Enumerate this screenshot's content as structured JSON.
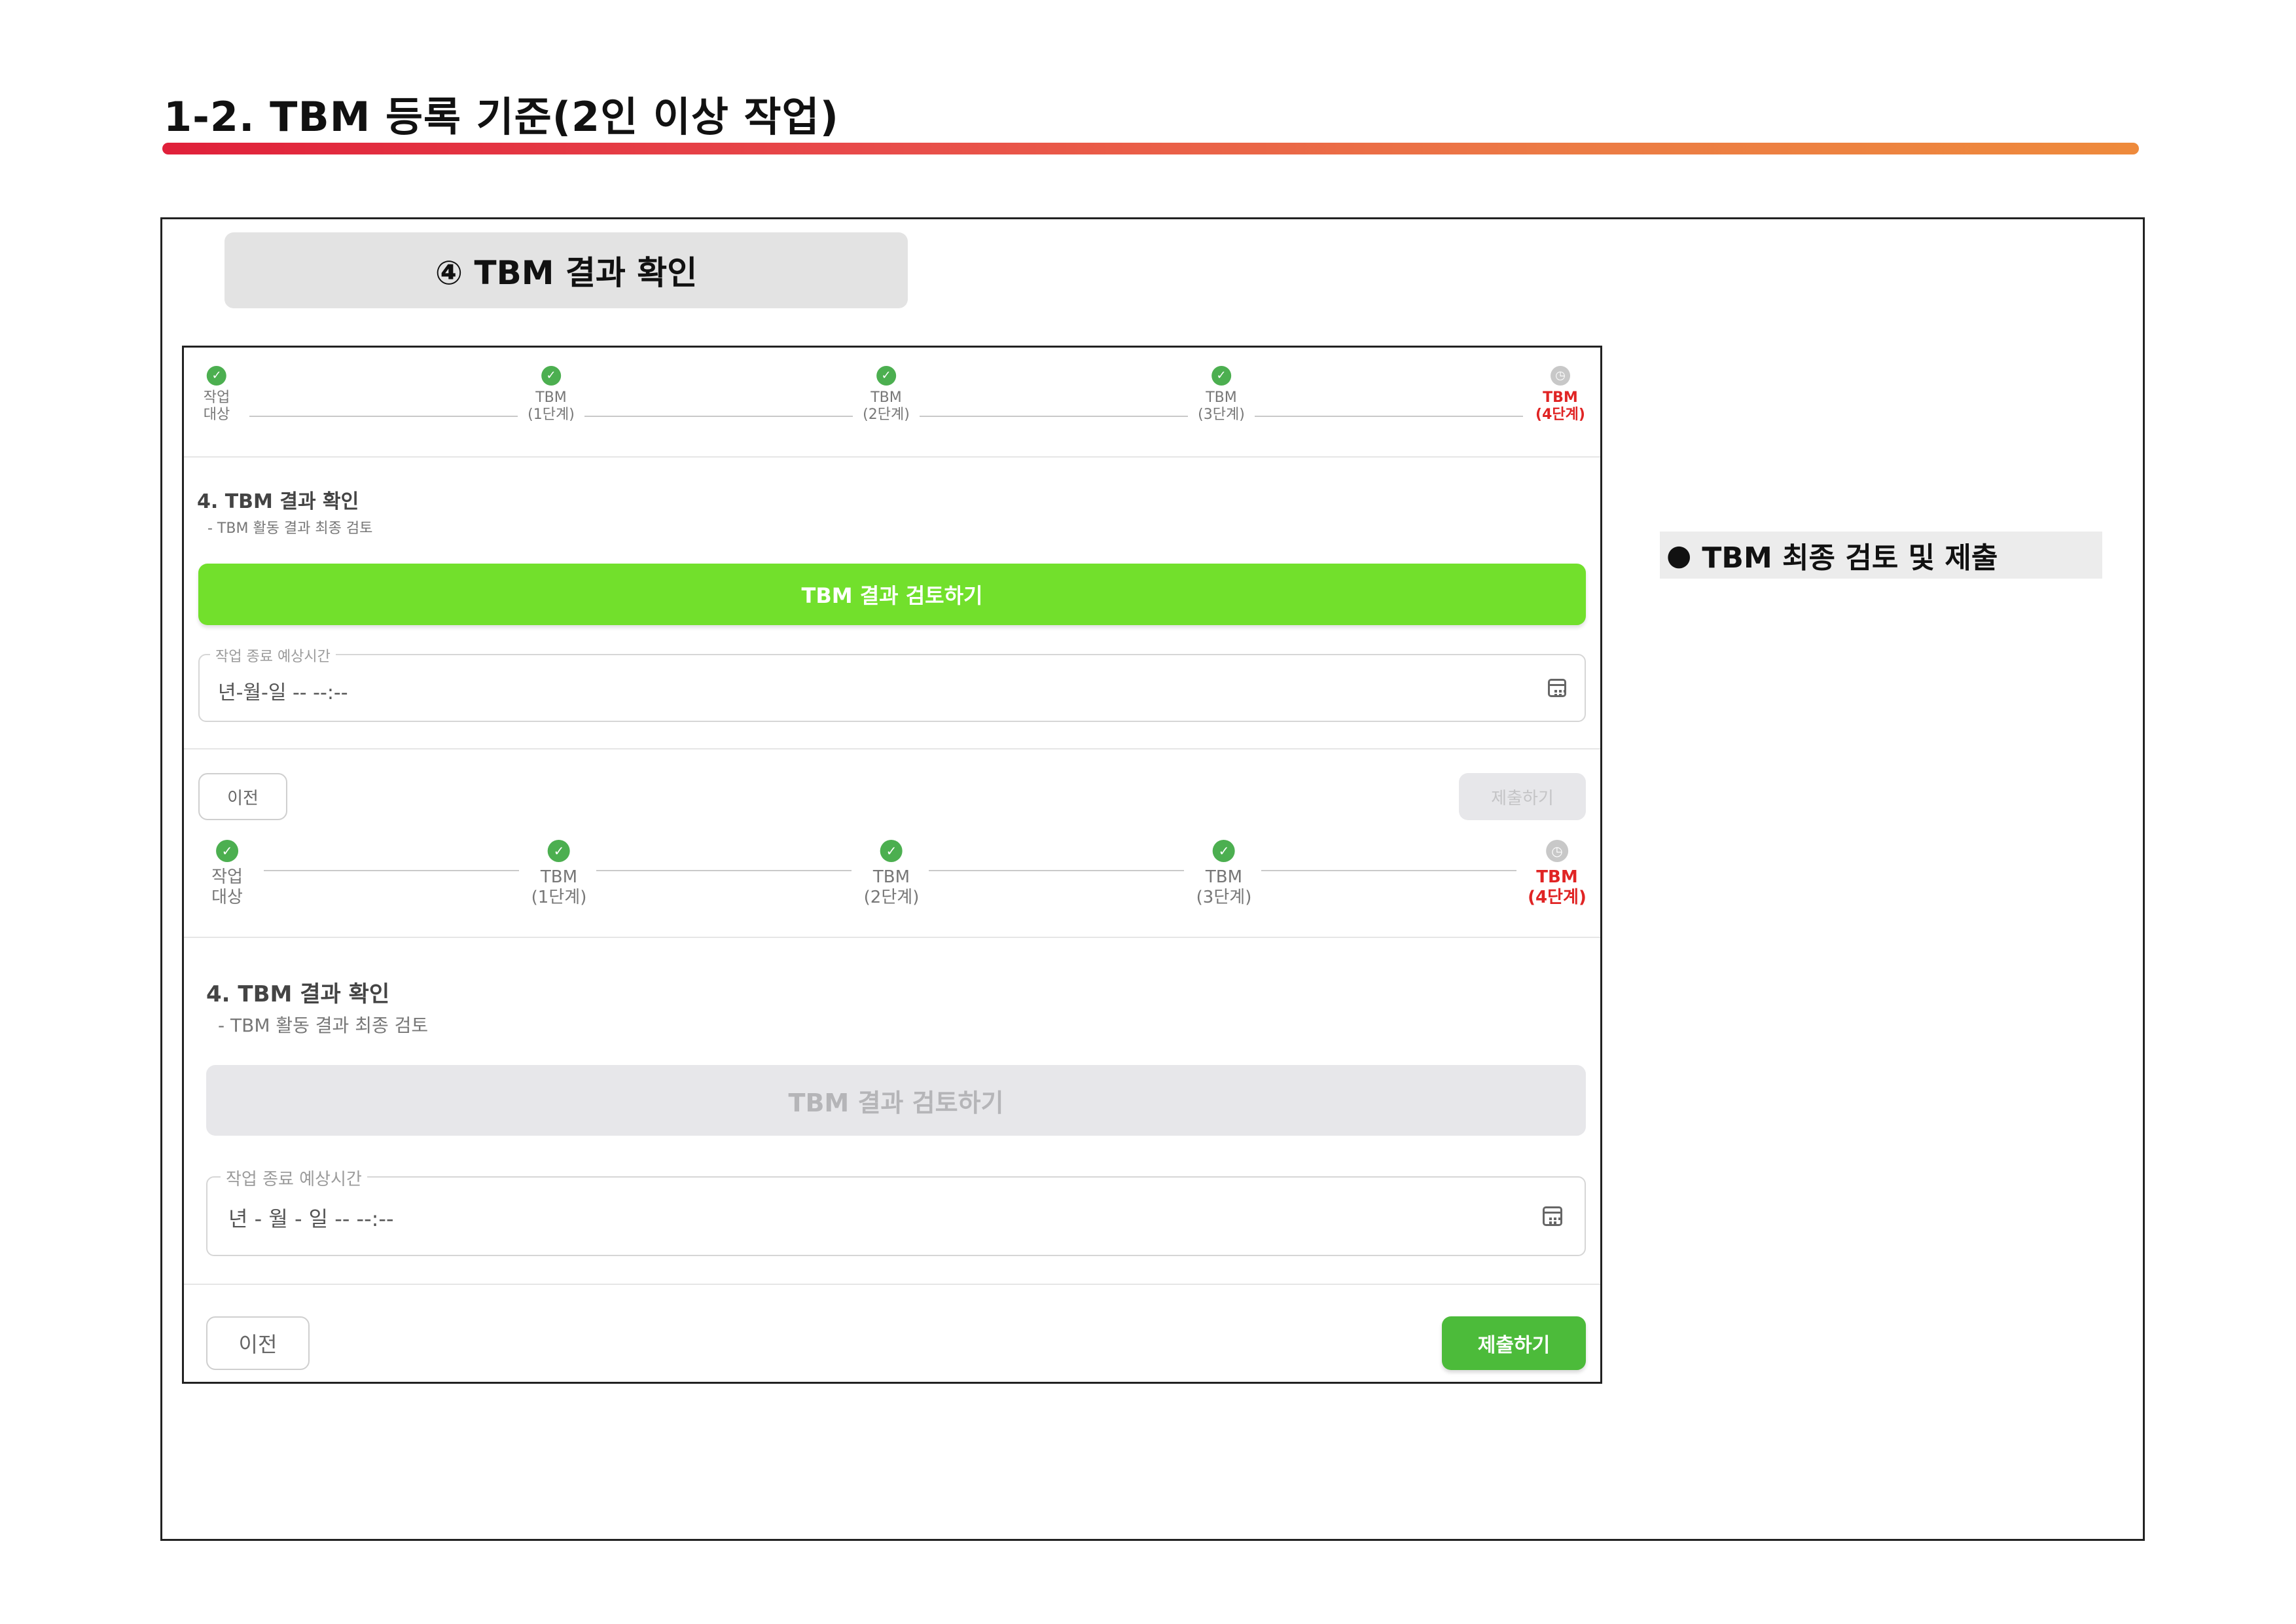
{
  "page": {
    "title": "1-2. TBM 등록 기준(2인 이상 작업)",
    "step_label": "④ TBM 결과 확인",
    "note": {
      "bullet": "●",
      "text": "TBM 최종 검토 및 제출"
    }
  },
  "colors": {
    "title_rule_start": "#e0203a",
    "title_rule_end": "#ee8a3c",
    "step_done": "#4caf50",
    "step_active_text": "#e02424",
    "review_button": "#72e02c",
    "submit_button": "#4cbb3a"
  },
  "stepper": {
    "check_icon": "✓",
    "pending_icon": "clock-icon",
    "steps": [
      {
        "line1": "작업",
        "line2": "대상",
        "state": "done"
      },
      {
        "line1": "TBM",
        "line2": "(1단계)",
        "state": "done"
      },
      {
        "line1": "TBM",
        "line2": "(2단계)",
        "state": "done"
      },
      {
        "line1": "TBM",
        "line2": "(3단계)",
        "state": "done"
      },
      {
        "line1": "TBM",
        "line2": "(4단계)",
        "state": "current"
      }
    ]
  },
  "section": {
    "heading": "4. TBM 결과 확인",
    "subheading": "- TBM 활동 결과 최종 검토",
    "review_button": "TBM 결과 검토하기",
    "datetime_label": "작업 종료 예상시간",
    "datetime_value_a": "년-월-일 -- --:--",
    "datetime_value_b": "년 - 월 - 일  -- --:--",
    "prev_button": "이전",
    "submit_button": "제출하기"
  }
}
